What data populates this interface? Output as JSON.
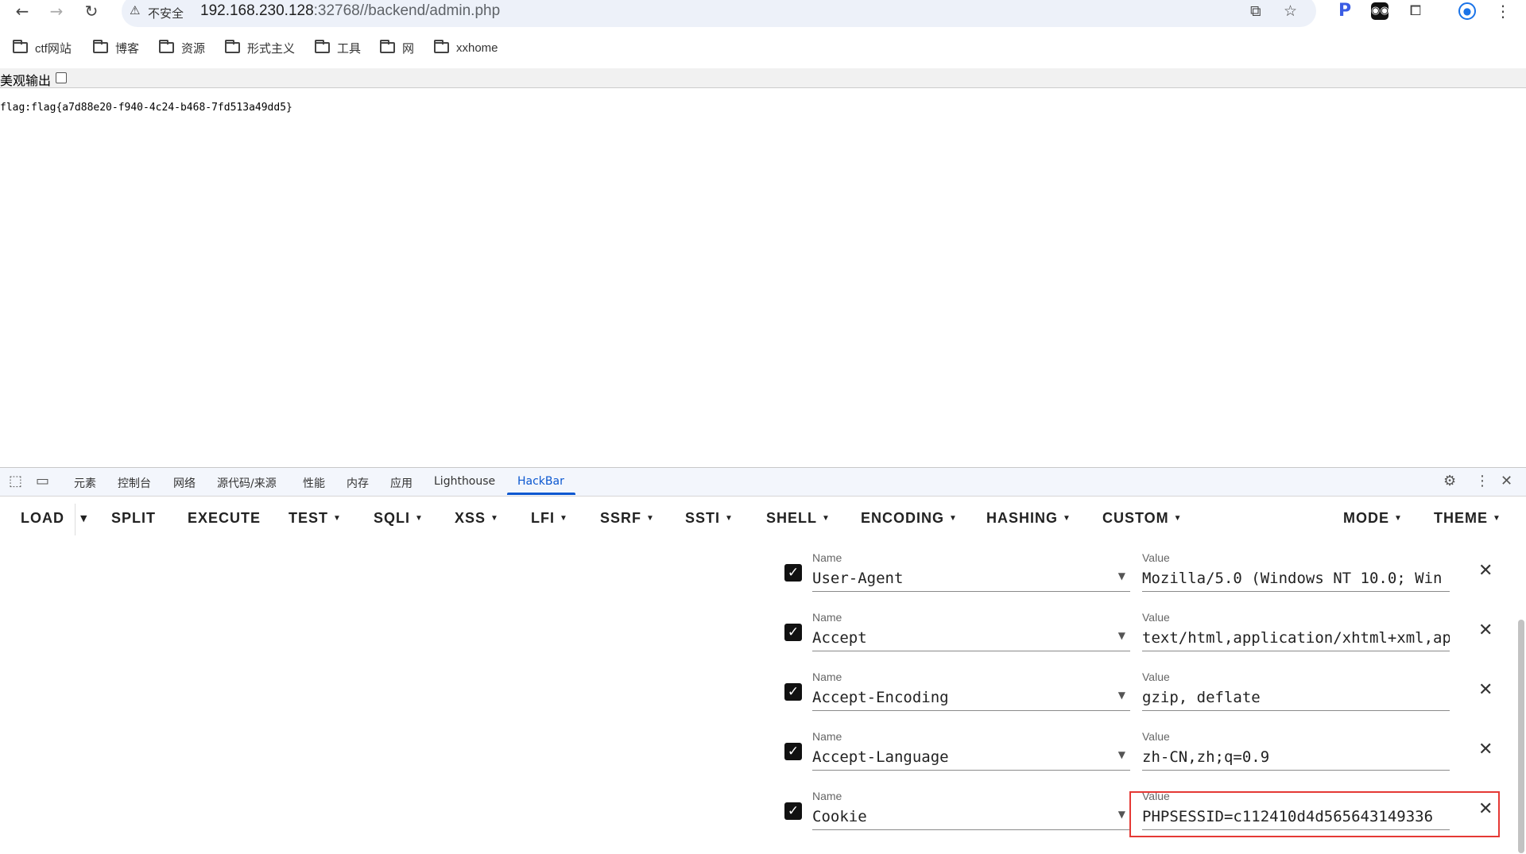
{
  "browser": {
    "security_label": "不安全",
    "url_host": "192.168.230.128",
    "url_rest": ":32768//backend/admin.php",
    "bookmarks": [
      "ctf网站",
      "博客",
      "资源",
      "形式主义",
      "工具",
      "网",
      "xxhome"
    ]
  },
  "page": {
    "option_label": "美观输出",
    "flag_text": "flag:flag{a7d88e20-f940-4c24-b468-7fd513a49dd5}"
  },
  "devtools": {
    "tabs": [
      "元素",
      "控制台",
      "网络",
      "源代码/来源",
      "性能",
      "内存",
      "应用",
      "Lighthouse",
      "HackBar"
    ],
    "active_tab": "HackBar"
  },
  "hackbar": {
    "buttons": {
      "load": "LOAD",
      "split": "SPLIT",
      "execute": "EXECUTE",
      "test": "TEST",
      "sqli": "SQLI",
      "xss": "XSS",
      "lfi": "LFI",
      "ssrf": "SSRF",
      "ssti": "SSTI",
      "shell": "SHELL",
      "encoding": "ENCODING",
      "hashing": "HASHING",
      "custom": "CUSTOM",
      "mode": "MODE",
      "theme": "THEME"
    },
    "field_labels": {
      "name": "Name",
      "value": "Value"
    },
    "headers": [
      {
        "enabled": true,
        "name": "User-Agent",
        "value": "Mozilla/5.0 (Windows NT 10.0; Win"
      },
      {
        "enabled": true,
        "name": "Accept",
        "value": "text/html,application/xhtml+xml,ap"
      },
      {
        "enabled": true,
        "name": "Accept-Encoding",
        "value": "gzip, deflate"
      },
      {
        "enabled": true,
        "name": "Accept-Language",
        "value": "zh-CN,zh;q=0.9"
      },
      {
        "enabled": true,
        "name": "Cookie",
        "value": "PHPSESSID=c112410d4d565643149336"
      }
    ]
  },
  "colors": {
    "accent": "#0b57d0",
    "highlight": "#e53935"
  }
}
